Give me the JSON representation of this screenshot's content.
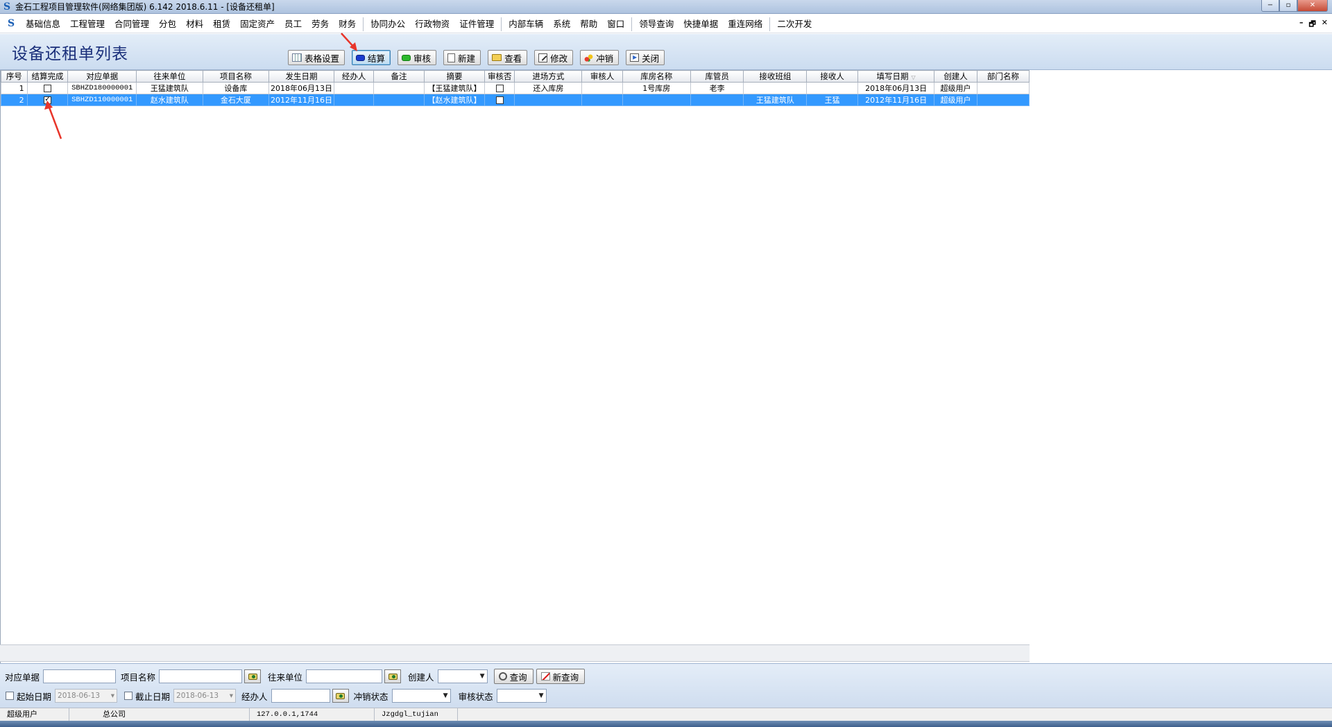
{
  "window": {
    "title": "金石工程项目管理软件(网络集团版) 6.142  2018.6.11 - [设备还租单]",
    "controls": {
      "minimize": "−",
      "restore": "▫",
      "close": "✕"
    }
  },
  "menu": {
    "items": [
      "基础信息",
      "工程管理",
      "合同管理",
      "分包",
      "材料",
      "租赁",
      "固定资产",
      "员工",
      "劳务",
      "财务",
      "|",
      "协同办公",
      "行政物资",
      "证件管理",
      "|",
      "内部车辆",
      "系统",
      "帮助",
      "窗口",
      "|",
      "领导查询",
      "快捷单据",
      "重连网络",
      "|",
      "二次开发"
    ],
    "mdi_controls": [
      "–",
      "🗗",
      "✕"
    ]
  },
  "header": {
    "title": "设备还租单列表"
  },
  "toolbar": {
    "buttons": [
      {
        "key": "grid-settings",
        "label": "表格设置",
        "icon": "grid-icon",
        "active": false
      },
      {
        "key": "settle",
        "label": "结算",
        "icon": "blue-pill-icon",
        "active": true
      },
      {
        "key": "audit",
        "label": "审核",
        "icon": "green-pill-icon",
        "active": false
      },
      {
        "key": "new",
        "label": "新建",
        "icon": "document-icon",
        "active": false
      },
      {
        "key": "view",
        "label": "查看",
        "icon": "folder-icon",
        "active": false
      },
      {
        "key": "edit",
        "label": "修改",
        "icon": "edit-icon",
        "active": false
      },
      {
        "key": "reverse",
        "label": "冲销",
        "icon": "paint-icon",
        "active": false
      },
      {
        "key": "close",
        "label": "关闭",
        "icon": "exit-icon",
        "active": false
      }
    ]
  },
  "grid": {
    "columns": [
      "序号",
      "结算完成",
      "对应单据",
      "往来单位",
      "项目名称",
      "发生日期",
      "经办人",
      "备注",
      "摘要",
      "审核否",
      "进场方式",
      "审核人",
      "库房名称",
      "库管员",
      "接收班组",
      "接收人",
      "填写日期",
      "创建人",
      "部门名称"
    ],
    "sort_glyph": "▽",
    "rows": [
      {
        "seq": "1",
        "settled": false,
        "doc": "SBHZD180000001",
        "unit": "王猛建筑队",
        "project": "设备库",
        "date": "2018年06月13日",
        "handler": "",
        "remark": "",
        "summary": "【王猛建筑队】",
        "audited": false,
        "entry": "还入库房",
        "auditor": "",
        "warehouse": "1号库房",
        "keeper": "老李",
        "team": "",
        "receiver": "",
        "filled": "2018年06月13日",
        "creator": "超级用户",
        "dept": "",
        "selected": false
      },
      {
        "seq": "2",
        "settled": true,
        "doc": "SBHZD110000001",
        "unit": "赵水建筑队",
        "project": "金石大厦",
        "date": "2012年11月16日",
        "handler": "",
        "remark": "",
        "summary": "【赵水建筑队】",
        "audited": false,
        "entry": "",
        "auditor": "",
        "warehouse": "",
        "keeper": "",
        "team": "王猛建筑队",
        "receiver": "王猛",
        "filled": "2012年11月16日",
        "creator": "超级用户",
        "dept": "",
        "selected": true
      }
    ]
  },
  "search": {
    "doc_label": "对应单据",
    "doc_value": "",
    "project_label": "项目名称",
    "project_value": "",
    "unit_label": "往来单位",
    "unit_value": "",
    "creator_label": "创建人",
    "creator_value": "",
    "query_label": "查询",
    "new_query_label": "新查询",
    "start_label": "起始日期",
    "start_value": "2018-06-13",
    "end_label": "截止日期",
    "end_value": "2018-06-13",
    "handler_label": "经办人",
    "handler_value": "",
    "reverse_label": "冲销状态",
    "reverse_value": "",
    "audit_label": "审核状态",
    "audit_value": ""
  },
  "status": {
    "user": "超级用户",
    "company": "总公司",
    "ip": "127.0.0.1,1744",
    "db": "Jzgdgl_tujian"
  },
  "colors": {
    "selected_row": "#3399ff",
    "title_text": "#1a2f7a",
    "annotation_arrow": "#e8352a"
  }
}
